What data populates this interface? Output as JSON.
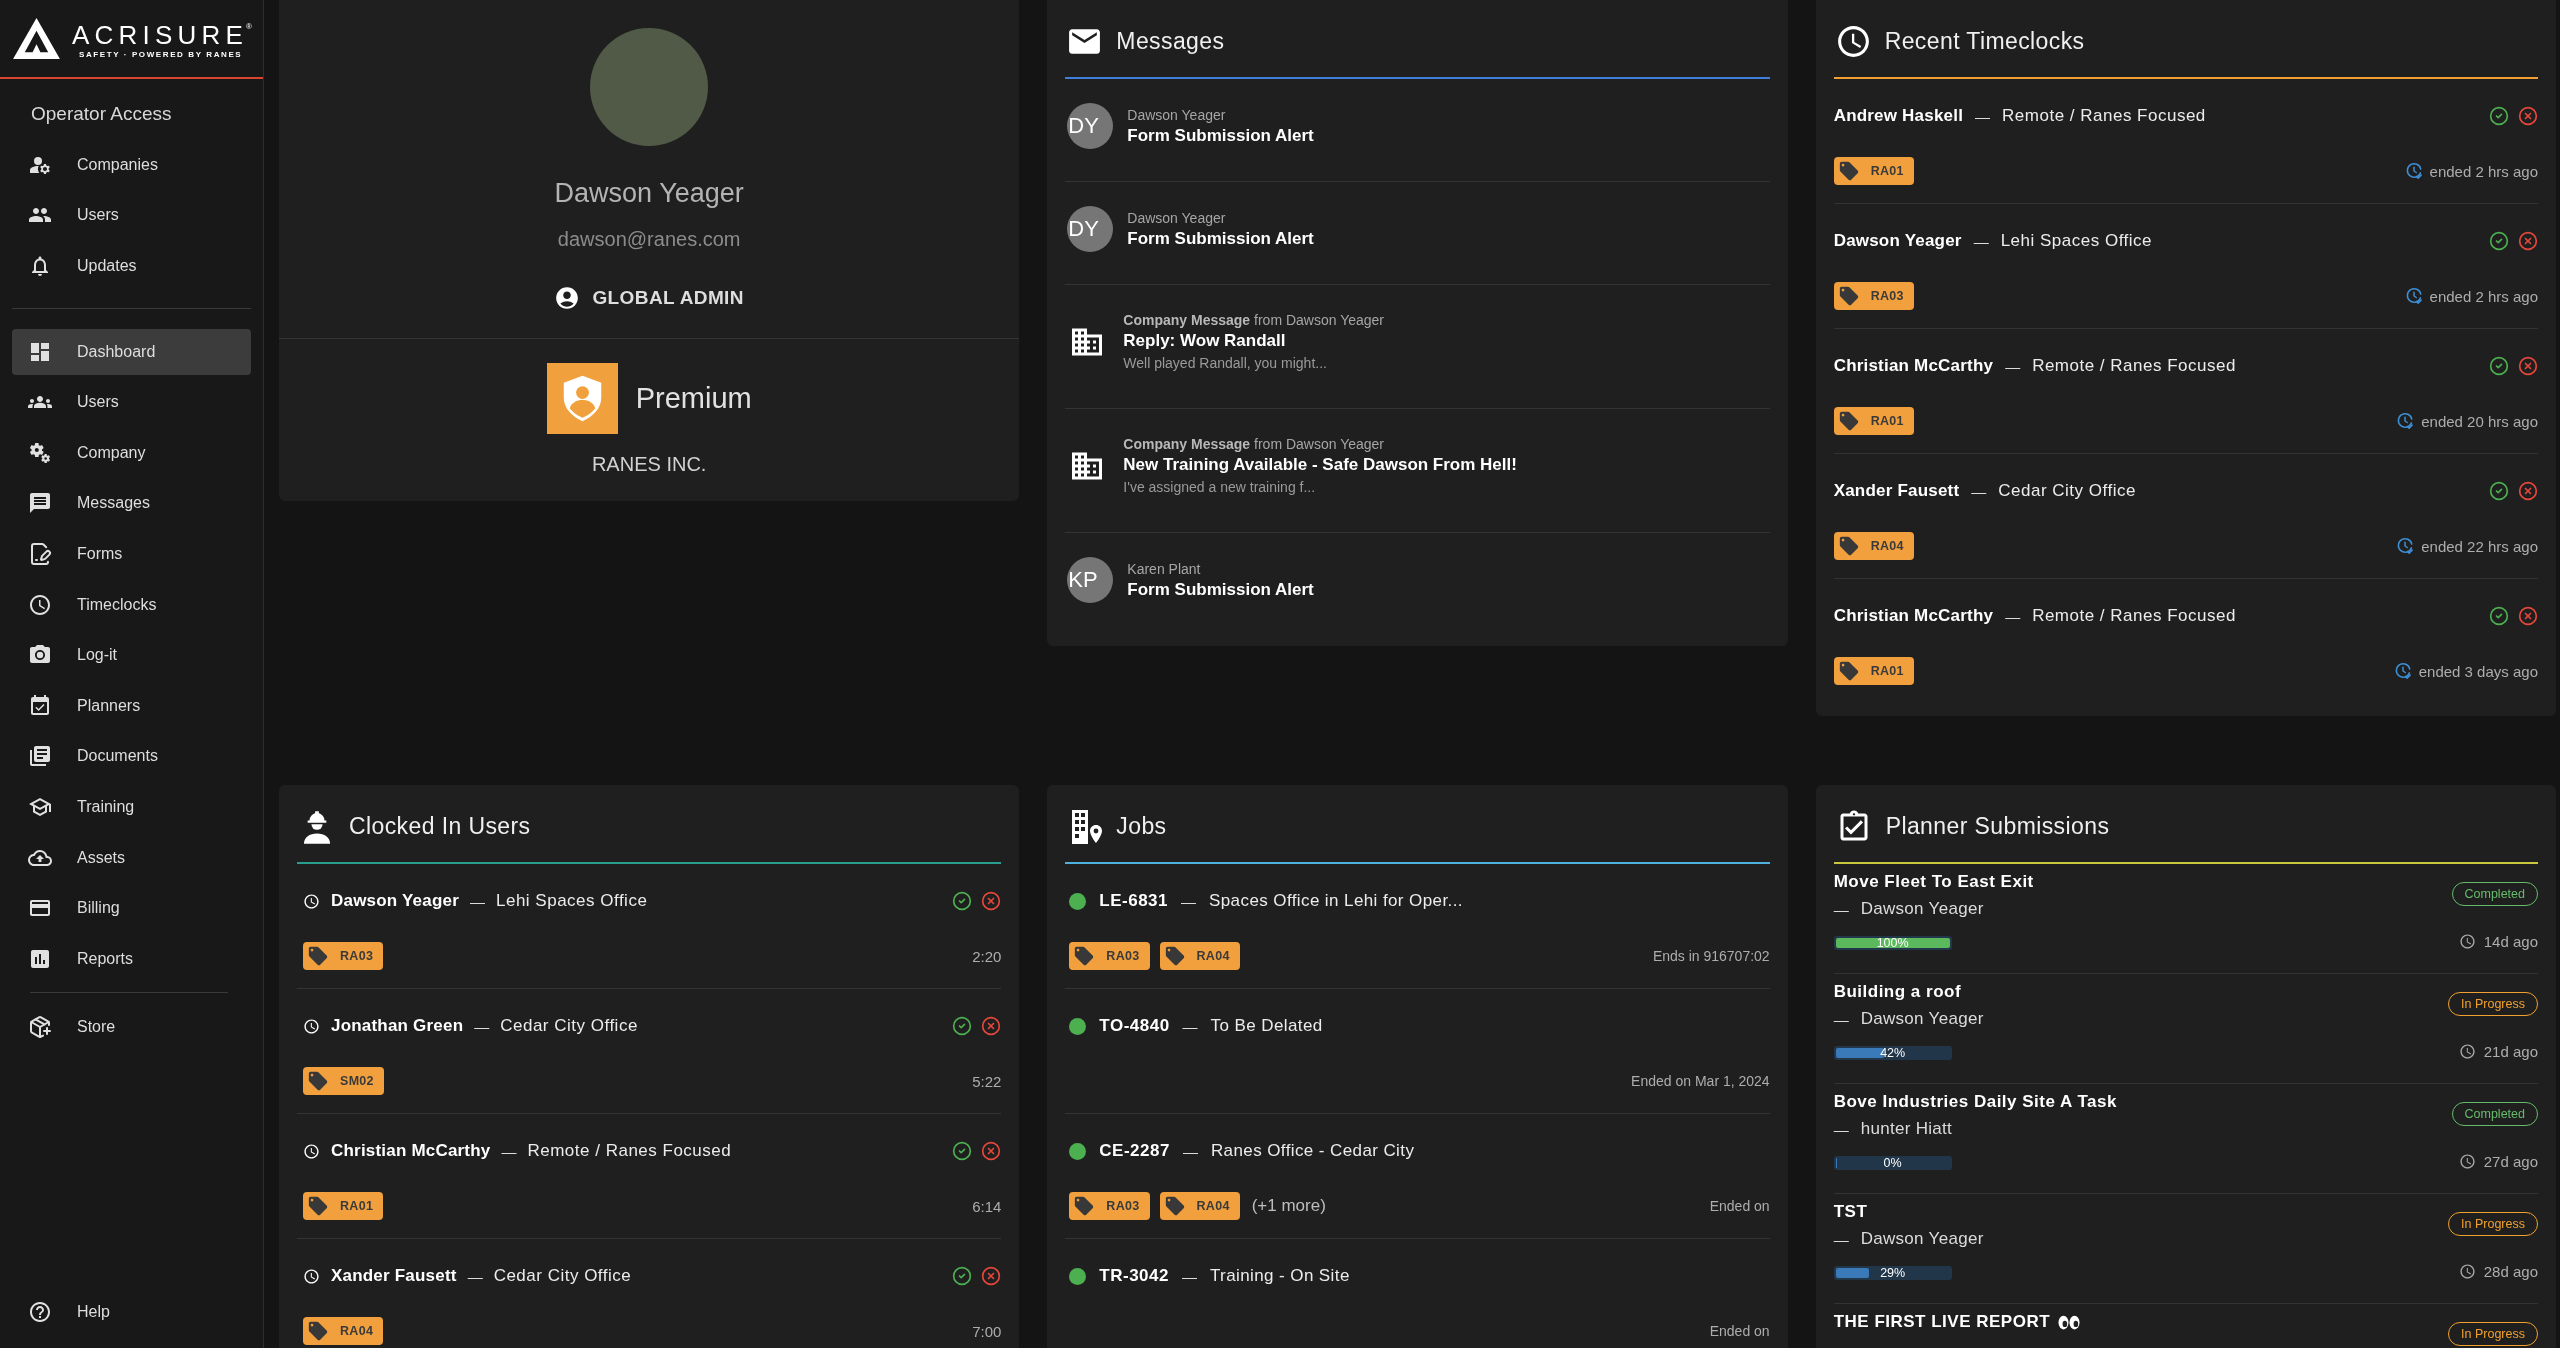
{
  "sidebar": {
    "logo": {
      "wordmark": "ACRISURE",
      "registered": "®",
      "tagline": "SAFETY · POWERED BY RANES"
    },
    "section_title": "Operator Access",
    "operator_items": [
      {
        "label": "Companies",
        "selected": false
      },
      {
        "label": "Users",
        "selected": false
      },
      {
        "label": "Updates",
        "selected": false
      }
    ],
    "main_items": [
      {
        "label": "Dashboard",
        "selected": true
      },
      {
        "label": "Users",
        "selected": false
      },
      {
        "label": "Company",
        "selected": false
      },
      {
        "label": "Messages",
        "selected": false
      },
      {
        "label": "Forms",
        "selected": false
      },
      {
        "label": "Timeclocks",
        "selected": false
      },
      {
        "label": "Log-it",
        "selected": false
      },
      {
        "label": "Planners",
        "selected": false
      },
      {
        "label": "Documents",
        "selected": false
      },
      {
        "label": "Training",
        "selected": false
      },
      {
        "label": "Assets",
        "selected": false
      },
      {
        "label": "Billing",
        "selected": false
      },
      {
        "label": "Reports",
        "selected": false
      }
    ],
    "extra_items": [
      {
        "label": "Store",
        "selected": false
      }
    ],
    "help": {
      "label": "Help"
    }
  },
  "profile": {
    "name": "Dawson Yeager",
    "email": "dawson@ranes.com",
    "role": "GLOBAL ADMIN",
    "plan": "Premium",
    "company": "RANES INC."
  },
  "messages": {
    "title": "Messages",
    "items": [
      {
        "kind": "user",
        "initials": "DY",
        "sender": "Dawson Yeager",
        "subject": "Form Submission Alert"
      },
      {
        "kind": "user",
        "initials": "DY",
        "sender": "Dawson Yeager",
        "subject": "Form Submission Alert"
      },
      {
        "kind": "company",
        "sender": "**Company Message** from Dawson Yeager",
        "subject": "Reply: Wow Randall",
        "preview": "Well played Randall, you might..."
      },
      {
        "kind": "company",
        "sender": "**Company Message** from Dawson Yeager",
        "subject": "New Training Available - Safe Dawson From Hell!",
        "preview": "I've assigned a new training f..."
      },
      {
        "kind": "user",
        "initials": "KP",
        "sender": "Karen Plant",
        "subject": "Form Submission Alert"
      }
    ]
  },
  "recent_timeclocks": {
    "title": "Recent Timeclocks",
    "items": [
      {
        "name": "Andrew Haskell",
        "dash": "—",
        "location": "Remote / Ranes Focused",
        "tags": [
          "RA01"
        ],
        "ended": "ended 2 hrs ago"
      },
      {
        "name": "Dawson Yeager",
        "dash": "—",
        "location": "Lehi Spaces Office",
        "tags": [
          "RA03"
        ],
        "ended": "ended 2 hrs ago"
      },
      {
        "name": "Christian McCarthy",
        "dash": "—",
        "location": "Remote / Ranes Focused",
        "tags": [
          "RA01"
        ],
        "ended": "ended 20 hrs ago"
      },
      {
        "name": "Xander Fausett",
        "dash": "—",
        "location": "Cedar City Office",
        "tags": [
          "RA04"
        ],
        "ended": "ended 22 hrs ago"
      },
      {
        "name": "Christian McCarthy",
        "dash": "—",
        "location": "Remote / Ranes Focused",
        "tags": [
          "RA01"
        ],
        "ended": "ended 3 days ago"
      }
    ]
  },
  "clocked_in_users": {
    "title": "Clocked In Users",
    "items": [
      {
        "name": "Dawson Yeager",
        "dash": "—",
        "location": "Lehi Spaces Office",
        "tags": [
          "RA03"
        ],
        "duration": "2:20"
      },
      {
        "name": "Jonathan Green",
        "dash": "—",
        "location": "Cedar City Office",
        "tags": [
          "SM02"
        ],
        "duration": "5:22"
      },
      {
        "name": "Christian McCarthy",
        "dash": "—",
        "location": "Remote / Ranes Focused",
        "tags": [
          "RA01"
        ],
        "duration": "6:14"
      },
      {
        "name": "Xander Fausett",
        "dash": "—",
        "location": "Cedar City Office",
        "tags": [
          "RA04"
        ],
        "duration": "7:00"
      }
    ]
  },
  "jobs": {
    "title": "Jobs",
    "items": [
      {
        "code": "LE-6831",
        "dash": "—",
        "name": "Spaces Office in Lehi for Oper...",
        "color": "#4caf50",
        "tags": [
          "RA03",
          "RA04"
        ],
        "schedule": "Ends in 916707:02"
      },
      {
        "code": "TO-4840",
        "dash": "—",
        "name": "To Be Delated",
        "color": "#4caf50",
        "schedule": "Ended on Mar 1, 2024"
      },
      {
        "code": "CE-2287",
        "dash": "—",
        "name": "Ranes Office - Cedar City",
        "color": "#4caf50",
        "tags": [
          "RA03",
          "RA04"
        ],
        "more": "(+1 more)",
        "schedule": "Ended on"
      },
      {
        "code": "TR-3042",
        "dash": "—",
        "name": "Training - On Site",
        "color": "#4caf50",
        "schedule": "Ended on"
      }
    ]
  },
  "planner_submissions": {
    "title": "Planner Submissions",
    "items": [
      {
        "kind": "completed",
        "title": "Move Fleet To East Exit",
        "dash": "—",
        "person": "Dawson Yeager",
        "level": 1,
        "percent": "100%",
        "status": "Completed",
        "age": "14d ago",
        "emoji": false
      },
      {
        "kind": "ongoing",
        "title": "Building a roof",
        "dash": "—",
        "person": "Dawson Yeager",
        "level": 0.42,
        "percent": "42%",
        "status": "In Progress",
        "age": "21d ago",
        "emoji": false
      },
      {
        "kind": "completed",
        "title": "Bove Industries Daily Site A Task",
        "dash": "—",
        "person": "hunter Hiatt",
        "level": 0,
        "percent": "0%",
        "status": "Completed",
        "age": "27d ago",
        "emoji": false
      },
      {
        "kind": "ongoing",
        "title": "TST",
        "dash": "—",
        "person": "Dawson Yeager",
        "level": 0.29,
        "percent": "29%",
        "status": "In Progress",
        "age": "28d ago",
        "emoji": false
      },
      {
        "kind": "ongoing",
        "title": "THE FIRST LIVE REPORT",
        "status": "In Progress",
        "emoji": true
      }
    ]
  }
}
